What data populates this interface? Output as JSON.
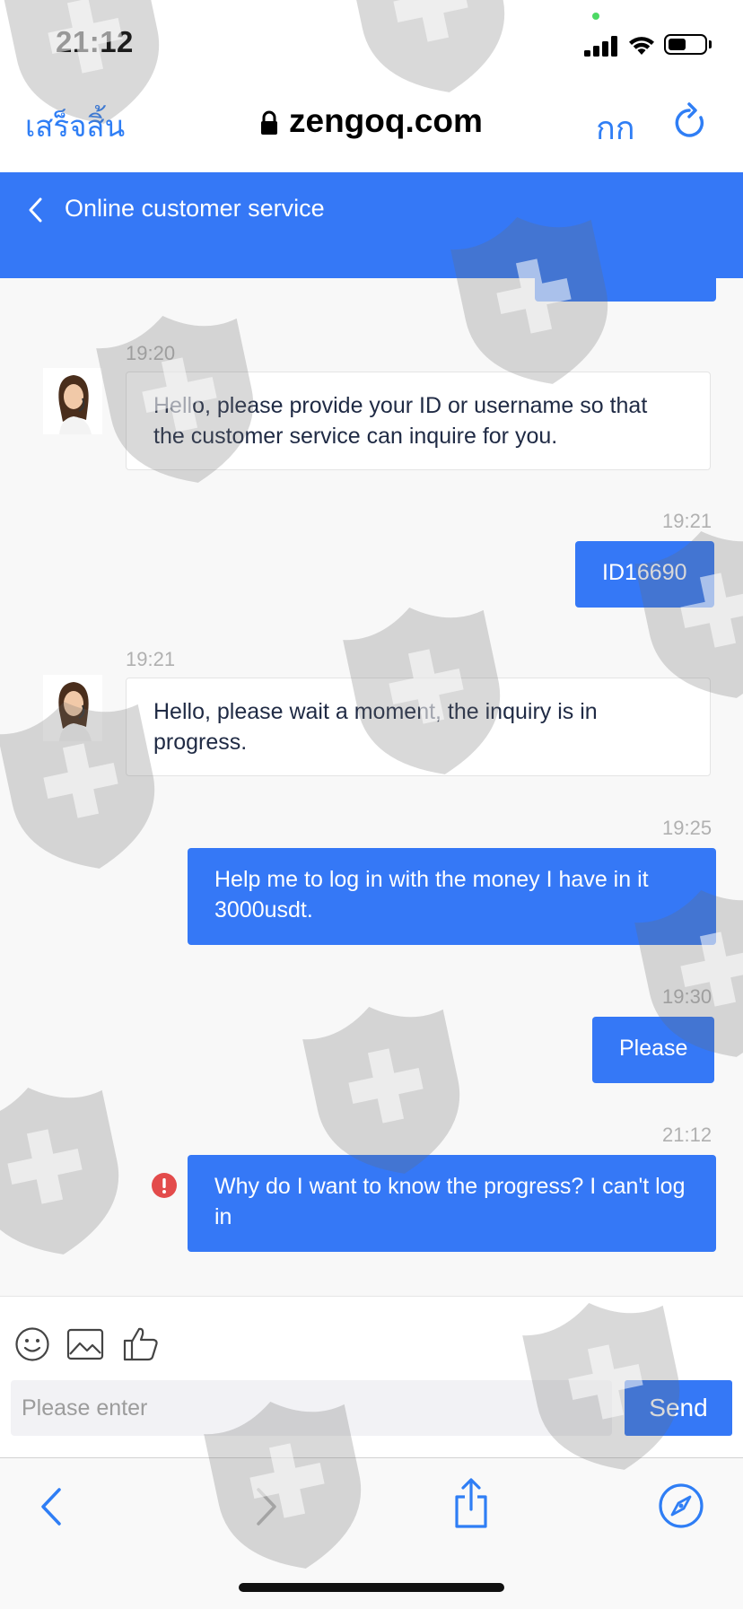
{
  "status_bar": {
    "time": "21:12"
  },
  "browser": {
    "done_label": "เสร็จสิ้น",
    "domain": "zengoq.com",
    "text_size_label": "กก"
  },
  "app": {
    "title": "Online customer service"
  },
  "messages": [
    {
      "time": "19:20",
      "side": "in",
      "text": "Hello, please provide your ID or username so that the customer service can inquire for you."
    },
    {
      "time": "19:21",
      "side": "out",
      "text": "ID16690"
    },
    {
      "time": "19:21",
      "side": "in",
      "text": "Hello, please wait a moment, the inquiry is in progress."
    },
    {
      "time": "19:25",
      "side": "out",
      "text": "Help me to log in with the money I have in it 3000usdt."
    },
    {
      "time": "19:30",
      "side": "out",
      "text": "Please"
    },
    {
      "time": "21:12",
      "side": "out",
      "text": "Why do I want to know the progress? I can't log in",
      "status": "error"
    }
  ],
  "composer": {
    "placeholder": "Please enter",
    "send_label": "Send",
    "tools": [
      "smiley-icon",
      "image-icon",
      "thumbs-up-icon"
    ]
  },
  "colors": {
    "accent": "#3578f6",
    "safari_blue": "#2f7ef5",
    "error": "#e34b4b"
  }
}
